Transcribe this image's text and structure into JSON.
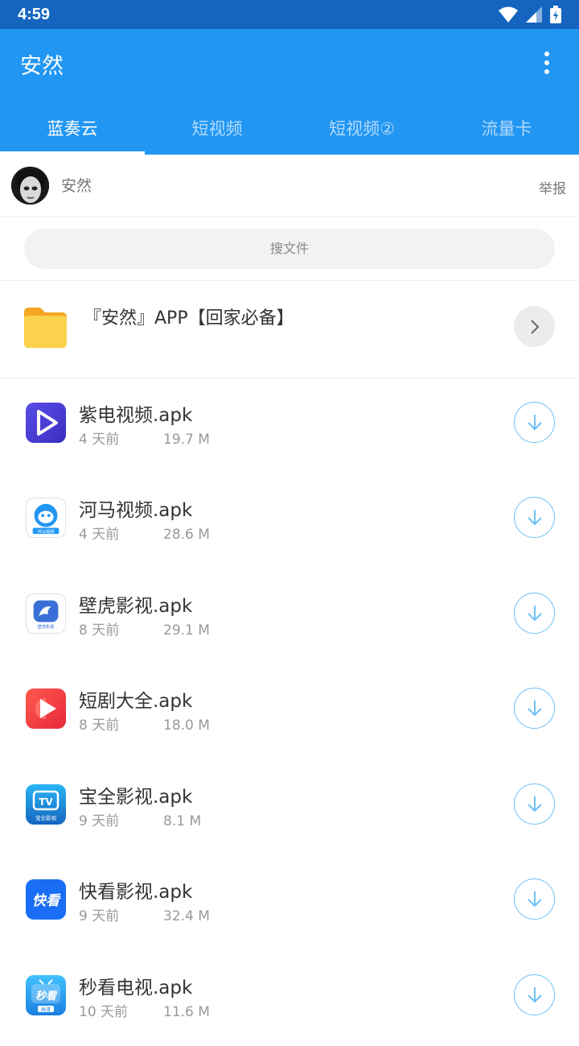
{
  "status": {
    "time": "4:59"
  },
  "app": {
    "title": "安然"
  },
  "tabs": [
    {
      "label": "蓝奏云",
      "active": true
    },
    {
      "label": "短视频",
      "active": false
    },
    {
      "label": "短视频②",
      "active": false
    },
    {
      "label": "流量卡",
      "active": false
    }
  ],
  "user": {
    "name": "安然",
    "report": "举报"
  },
  "search": {
    "placeholder": "搜文件"
  },
  "folder": {
    "title": "『安然』APP【回家必备】"
  },
  "files": [
    {
      "name": "紫电视频.apk",
      "date": "4 天前",
      "size": "19.7 M",
      "icon": "purple-play-icon",
      "color": "#4a3fd6"
    },
    {
      "name": "河马视频.apk",
      "date": "4 天前",
      "size": "28.6 M",
      "icon": "hippo-icon",
      "color": "#2196f3"
    },
    {
      "name": "壁虎影视.apk",
      "date": "8 天前",
      "size": "29.1 M",
      "icon": "gecko-icon",
      "color": "#3a6fd8"
    },
    {
      "name": "短剧大全.apk",
      "date": "8 天前",
      "size": "18.0 M",
      "icon": "red-play-icon",
      "color": "#f23b3b"
    },
    {
      "name": "宝全影视.apk",
      "date": "9 天前",
      "size": "8.1 M",
      "icon": "tv-icon",
      "color": "#1e88e5"
    },
    {
      "name": "快看影视.apk",
      "date": "9 天前",
      "size": "32.4 M",
      "icon": "kuaikan-icon",
      "color": "#1a6ef5"
    },
    {
      "name": "秒看电视.apk",
      "date": "10 天前",
      "size": "11.6 M",
      "icon": "miaokan-icon",
      "color": "#1f9cf0"
    }
  ],
  "icon_text": {
    "hippo": "河马视频",
    "gecko": "壁虎影视",
    "tv": "TV",
    "baoquan": "宝全影视",
    "kuaikan": "快看",
    "miaokan": "秒看",
    "gaoqing": "高清"
  },
  "colors": {
    "status_bar": "#1565c0",
    "app_bar": "#2196f3",
    "accent": "#6ec1f5",
    "folder": "#f9c23c"
  }
}
